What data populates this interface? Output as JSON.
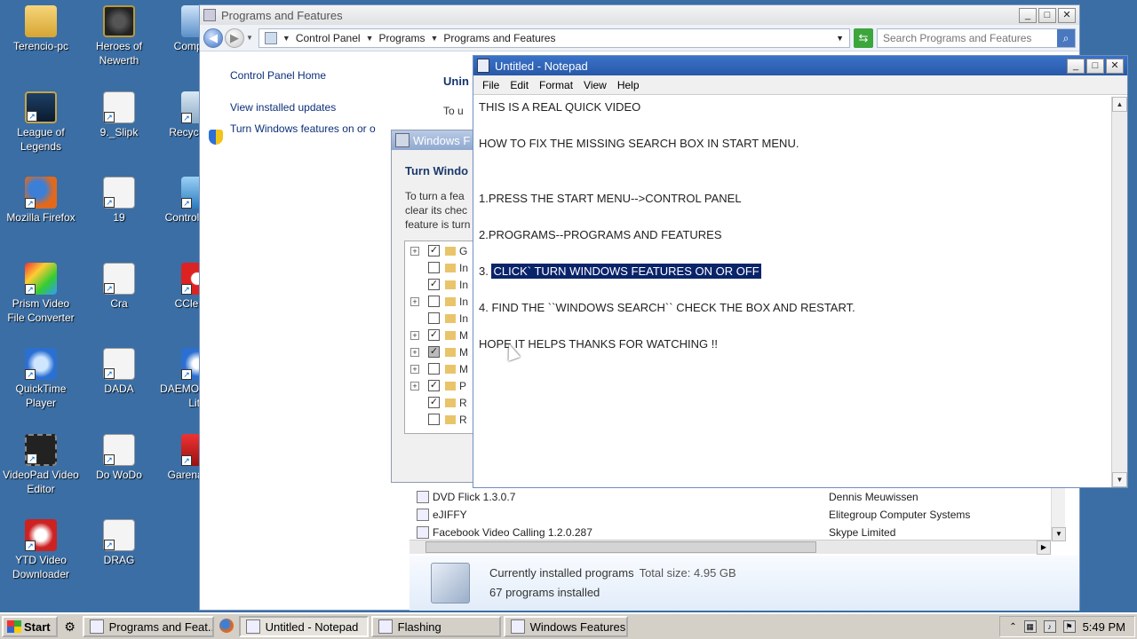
{
  "desktop": {
    "icons": [
      {
        "label": "Terencio-pc",
        "icon": "folder-icon"
      },
      {
        "label": "Heroes of Newerth",
        "icon": "hon-icon"
      },
      {
        "label": "Computer",
        "icon": "computer-icon"
      },
      {
        "label": "League of Legends",
        "icon": "league-of-legends-icon"
      },
      {
        "label": "9._Slipk",
        "icon": "file-icon"
      },
      {
        "label": "Recycle Bin",
        "icon": "recycle-bin-icon"
      },
      {
        "label": "Mozilla Firefox",
        "icon": "firefox-icon"
      },
      {
        "label": "19",
        "icon": "file-icon"
      },
      {
        "label": "Control Panel",
        "icon": "control-panel-icon"
      },
      {
        "label": "Prism Video File Converter",
        "icon": "prism-icon"
      },
      {
        "label": "Cra",
        "icon": "file-icon"
      },
      {
        "label": "CCleaner",
        "icon": "ccleaner-icon"
      },
      {
        "label": "QuickTime Player",
        "icon": "quicktime-icon"
      },
      {
        "label": "DADA",
        "icon": "file-icon"
      },
      {
        "label": "DAEMON Tools Lite",
        "icon": "daemon-tools-icon"
      },
      {
        "label": "VideoPad Video Editor",
        "icon": "videopad-icon"
      },
      {
        "label": "Do WoDo",
        "icon": "file-icon"
      },
      {
        "label": "Garena Plus",
        "icon": "garena-icon"
      },
      {
        "label": "YTD Video Downloader",
        "icon": "ytd-icon"
      },
      {
        "label": "DRAG",
        "icon": "file-icon"
      }
    ]
  },
  "programs_window": {
    "title": "Programs and Features",
    "breadcrumb": [
      "Control Panel",
      "Programs",
      "Programs and Features"
    ],
    "search_placeholder": "Search Programs and Features",
    "side_links": [
      "Control Panel Home",
      "View installed updates",
      "Turn Windows features on or o"
    ],
    "heading": "Unin",
    "subheading": "To u",
    "programs": [
      {
        "name": "DVD Flick 1.3.0.7",
        "publisher": "Dennis Meuwissen"
      },
      {
        "name": "eJIFFY",
        "publisher": "Elitegroup Computer Systems"
      },
      {
        "name": "Facebook Video Calling 1.2.0.287",
        "publisher": "Skype Limited"
      }
    ],
    "details": {
      "label": "Currently installed programs",
      "total_label": "Total size: 4.95 GB",
      "count_text": "67 programs installed"
    }
  },
  "features_dialog": {
    "title": "Windows F",
    "heading": "Turn Windo",
    "desc_lines": [
      "To turn a fea",
      "clear its chec",
      "feature is turn"
    ],
    "tree": [
      {
        "expand": true,
        "state": "checked",
        "label": "G"
      },
      {
        "expand": false,
        "state": "unchecked",
        "label": "In"
      },
      {
        "expand": false,
        "state": "checked",
        "label": "In"
      },
      {
        "expand": true,
        "state": "unchecked",
        "label": "In"
      },
      {
        "expand": false,
        "state": "unchecked",
        "label": "In"
      },
      {
        "expand": true,
        "state": "checked",
        "label": "M"
      },
      {
        "expand": true,
        "state": "partial",
        "label": "M"
      },
      {
        "expand": true,
        "state": "unchecked",
        "label": "M"
      },
      {
        "expand": true,
        "state": "checked",
        "label": "P"
      },
      {
        "expand": false,
        "state": "checked",
        "label": "R"
      },
      {
        "expand": false,
        "state": "unchecked",
        "label": "R"
      }
    ]
  },
  "notepad": {
    "title": "Untitled - Notepad",
    "menu": [
      "File",
      "Edit",
      "Format",
      "View",
      "Help"
    ],
    "lines": [
      "THIS IS A REAL QUICK VIDEO",
      "HOW TO FIX THE MISSING SEARCH BOX IN START MENU.",
      "1.PRESS THE START MENU-->CONTROL PANEL",
      "2.PROGRAMS--PROGRAMS AND FEATURES",
      "3. ",
      "4. FIND THE ``WINDOWS SEARCH`` CHECK THE BOX AND RESTART.",
      "HOPE IT HELPS THANKS FOR WATCHING !!"
    ],
    "selected_text": "CLICK` TURN WINDOWS FEATURES ON OR OFF"
  },
  "taskbar": {
    "start_label": "Start",
    "tasks": [
      {
        "label": "Programs and Feat...",
        "active": false
      },
      {
        "label": "Untitled - Notepad",
        "active": true
      },
      {
        "label": "Flashing",
        "active": false
      },
      {
        "label": "Windows Features",
        "active": false
      }
    ],
    "clock": "5:49 PM"
  },
  "colors": {
    "desktop": "#3a6ea5",
    "selection": "#0a246a",
    "notepad_title": "#2858a8"
  }
}
